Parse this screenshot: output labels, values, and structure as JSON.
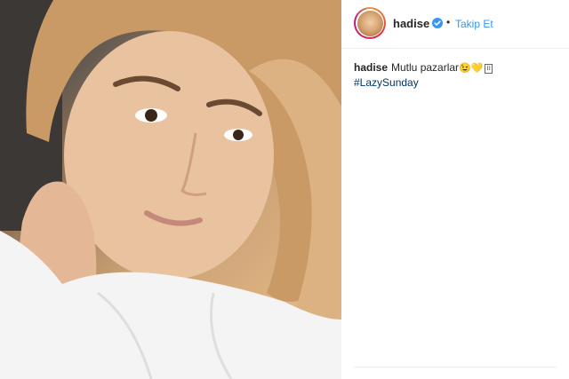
{
  "post": {
    "username": "hadise",
    "follow_label": "Takip Et",
    "separator": "•",
    "caption": {
      "username": "hadise",
      "text": "Mutlu pazarlar",
      "emoji_1": "😉",
      "emoji_2": "💛",
      "hashtag": "#LazySunday"
    }
  },
  "icons": {
    "verified": "verified-badge-icon",
    "avatar": "profile-avatar"
  },
  "colors": {
    "follow_link": "#3897f0",
    "verified_badge": "#3897f0",
    "hashtag": "#003569",
    "text": "#262626"
  }
}
